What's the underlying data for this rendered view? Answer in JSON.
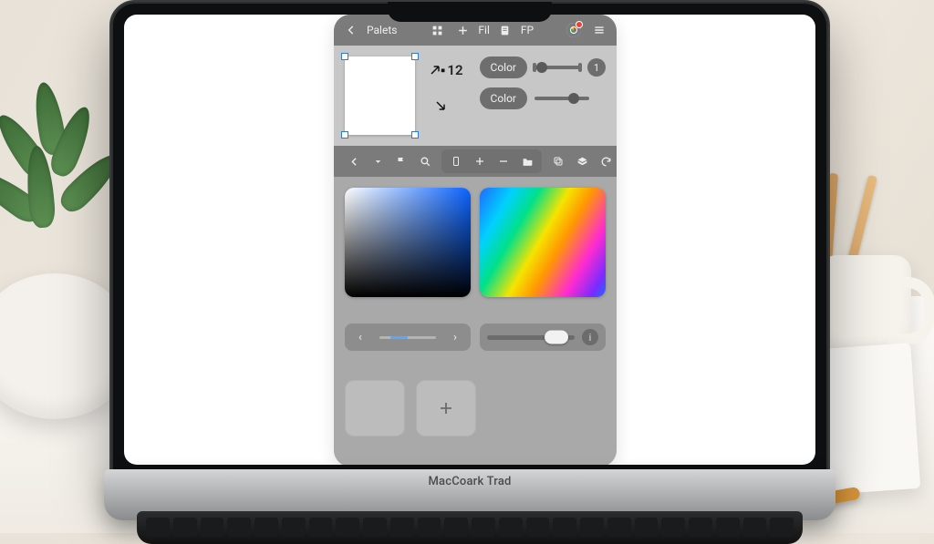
{
  "brand_label": "MacCoark Trad",
  "topbar": {
    "back_icon": "arrow-left",
    "title": "Palets",
    "grid_icon": "grid",
    "plus_icon": "plus",
    "fill_label": "Fil",
    "note_icon": "note",
    "fp_label": "FP",
    "logo": "chrome",
    "menu_icon": "menu"
  },
  "properties": {
    "canvas_value": "12",
    "arrow_ne_icon": "arrow-ne",
    "arrow_se_icon": "arrow-se",
    "color1_label": "Color",
    "color1_slider_value": 15,
    "color1_badge": "1",
    "color2_label": "Color",
    "color2_slider_value": 72
  },
  "iconbar": {
    "back": "chevron-left",
    "dropdown": "caret-down",
    "flag": "flag",
    "search": "search",
    "device": "device",
    "plus": "plus",
    "minus": "minus",
    "folder": "folder",
    "copy": "copy",
    "layers": "layers",
    "redo": "redo"
  },
  "controls": {
    "prev": "‹",
    "next": "›",
    "toggle_value": 80,
    "info": "i"
  },
  "swatches": {
    "count": 2,
    "add_icon": "plus"
  },
  "colors": {
    "panel_bg": "#bfbfbf",
    "bar_bg": "#7b7b7b",
    "picker_bg": "#a9a9a9",
    "accent": "#2f7bd1"
  }
}
